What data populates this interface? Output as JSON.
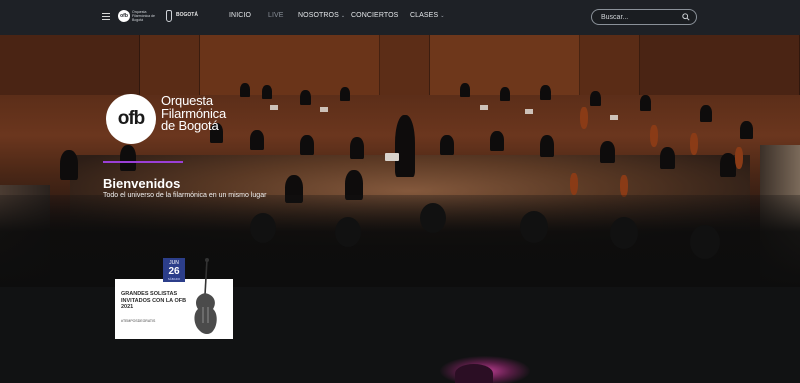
{
  "nav": {
    "logo_small": "ofb",
    "logo_small_text": "Orquesta Filarmónica de Bogotá",
    "bogota_label": "BOGOTÁ",
    "links": [
      {
        "label": "INICIO"
      },
      {
        "label": "LIVE"
      },
      {
        "label": "NOSOTROS"
      },
      {
        "label": "CONCIERTOS"
      },
      {
        "label": "CLASES"
      }
    ],
    "search_placeholder": "Buscar..."
  },
  "hero": {
    "logo_mark": "ofb",
    "logo_line1": "Orquesta",
    "logo_line2": "Filarmónica",
    "logo_line3": "de Bogotá",
    "title": "Bienvenidos",
    "subtitle": "Todo el universo de la filarmónica en un mismo lugar"
  },
  "event": {
    "month": "JUN",
    "day": "26",
    "day_label": "SÁBADO",
    "title": "GRANDES SOLISTAS INVITADOS CON LA OFB 2021",
    "hashtag": "#TEMPOSDEGRATIS"
  },
  "colors": {
    "nav_bg": "#1e2126",
    "accent": "#9a3fd6",
    "date_badge": "#2c3e8a"
  }
}
